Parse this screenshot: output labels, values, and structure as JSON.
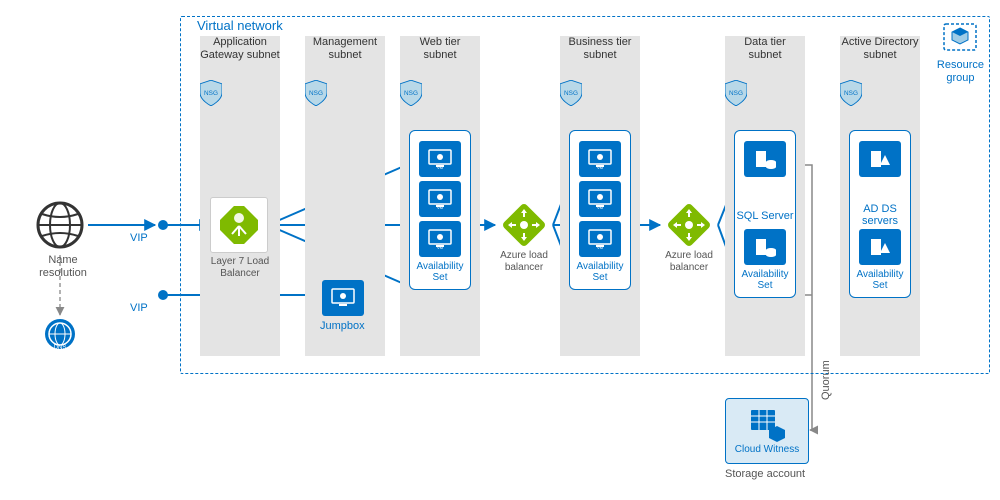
{
  "vnet": {
    "label": "Virtual network"
  },
  "subnets": {
    "app_gw": {
      "label": "Application\nGateway subnet",
      "nsg": "NSG"
    },
    "mgmt": {
      "label": "Management\nsubnet",
      "nsg": "NSG"
    },
    "web": {
      "label": "Web tier\nsubnet",
      "nsg": "NSG"
    },
    "biz": {
      "label": "Business tier\nsubnet",
      "nsg": "NSG"
    },
    "data": {
      "label": "Data tier\nsubnet",
      "nsg": "NSG"
    },
    "ad": {
      "label": "Active Directory\nsubnet",
      "nsg": "NSG"
    }
  },
  "left": {
    "name_resolution": "Name\nresolution",
    "dns": "DNS",
    "vip1": "VIP",
    "vip2": "VIP"
  },
  "lb": {
    "l7": "Layer 7 Load\nBalancer",
    "azure1": "Azure load\nbalancer",
    "azure2": "Azure load\nbalancer"
  },
  "availset_label": "Availability\nSet",
  "jumpbox": "Jumpbox",
  "sql_server": "SQL Server",
  "ad_ds": "AD DS\nservers",
  "cloud_witness": "Cloud Witness",
  "storage_account": "Storage account",
  "quorum": "Quorum",
  "resource_group": "Resource\ngroup",
  "vm_tile_caption": "VM"
}
